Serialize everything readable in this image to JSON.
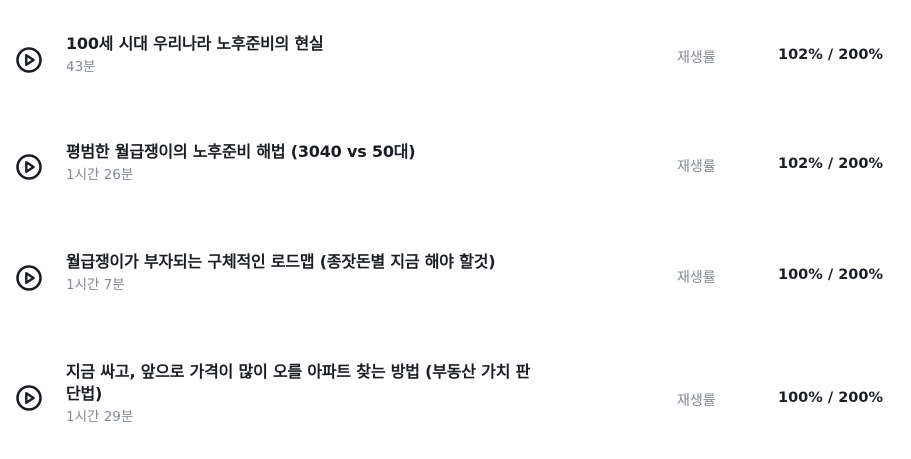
{
  "rate_label": "재생률",
  "lectures": [
    {
      "title": "100세 시대 우리나라 노후준비의 현실",
      "duration": "43분",
      "rate": "102% / 200%"
    },
    {
      "title": "평범한 월급쟁이의 노후준비 해법 (3040 vs 50대)",
      "duration": "1시간 26분",
      "rate": "102% / 200%"
    },
    {
      "title": "월급쟁이가 부자되는 구체적인 로드맵 (종잣돈별 지금 해야 할것)",
      "duration": "1시간 7분",
      "rate": "100% / 200%"
    },
    {
      "title_line1": "지금 싸고, 앞으로 가격이 많이 오를 아파트 찾는 방법 (부동산 가치 판",
      "title_line2": "단법)",
      "duration": "1시간 29분",
      "rate": "100% / 200%"
    }
  ]
}
